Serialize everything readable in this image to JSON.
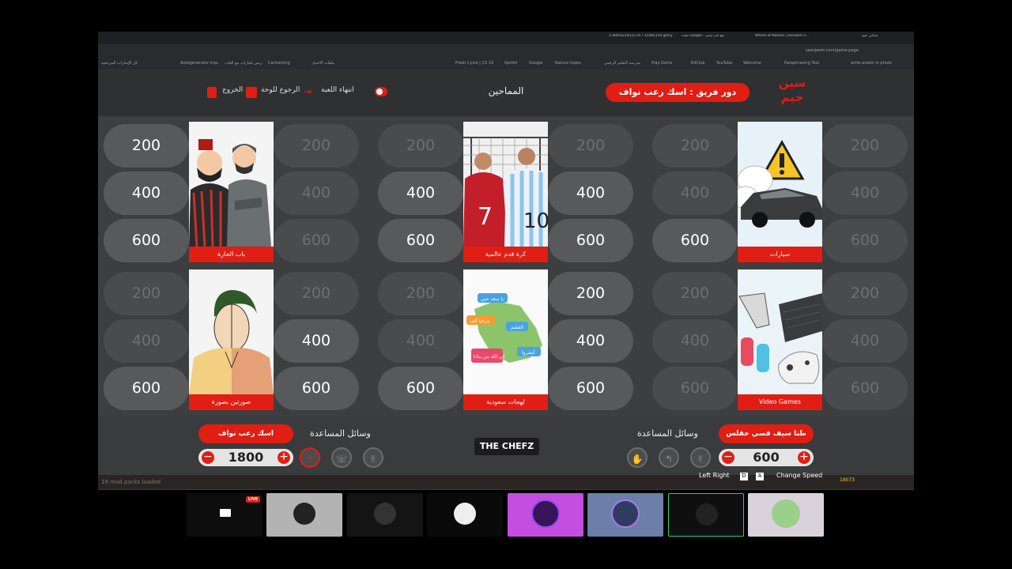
{
  "browser": {
    "tabs": [
      "17805021815176 / 31485150 gerry",
      "بحث Google - مع حب ليدي",
      "Wheel of Names | Random n...",
      "ساعي جيم"
    ],
    "url": "seenjeem.com/game-page",
    "bookmarks": [
      "كل الإشارات المرجعية",
      "Autogenerator input",
      "تدريس اشارات مع ألعاب",
      "Cartooning",
      "ملفات الاختبار",
      "Fresh Cycle | CS 101",
      "lipsfell",
      "Google",
      "Natura trajes",
      "مدرسة التعليم الرقمي",
      "Play Game",
      "EdClub",
      "YouTube",
      "Welcome",
      "Paraphrasing Tool",
      "write arabic in photo"
    ]
  },
  "header": {
    "team_turn_label": "دور فريق : اسك رعب نواف",
    "title": "المماحين",
    "end_game": "انتهاء اللعبة",
    "back_to_board": "الرجوع للوحة",
    "exit": "الخروج",
    "logo": "سين جيم",
    "brand_color": "#e01e14"
  },
  "board": {
    "categories": [
      {
        "name": "باب الحارة",
        "left": [
          {
            "v": "200",
            "used": false
          },
          {
            "v": "400",
            "used": false
          },
          {
            "v": "600",
            "used": false
          }
        ],
        "right": [
          {
            "v": "200",
            "used": true
          },
          {
            "v": "400",
            "used": true
          },
          {
            "v": "600",
            "used": true
          }
        ]
      },
      {
        "name": "كرة قدم عالمية",
        "left": [
          {
            "v": "200",
            "used": true
          },
          {
            "v": "400",
            "used": false
          },
          {
            "v": "600",
            "used": false
          }
        ],
        "right": [
          {
            "v": "200",
            "used": true
          },
          {
            "v": "400",
            "used": false
          },
          {
            "v": "600",
            "used": false
          }
        ]
      },
      {
        "name": "سيارات",
        "left": [
          {
            "v": "200",
            "used": true
          },
          {
            "v": "400",
            "used": true
          },
          {
            "v": "600",
            "used": false
          }
        ],
        "right": [
          {
            "v": "200",
            "used": true
          },
          {
            "v": "400",
            "used": true
          },
          {
            "v": "600",
            "used": true
          }
        ]
      },
      {
        "name": "صورتين بصورة",
        "left": [
          {
            "v": "200",
            "used": true
          },
          {
            "v": "400",
            "used": true
          },
          {
            "v": "600",
            "used": false
          }
        ],
        "right": [
          {
            "v": "200",
            "used": true
          },
          {
            "v": "400",
            "used": false
          },
          {
            "v": "600",
            "used": false
          }
        ]
      },
      {
        "name": "لهجات سعودية",
        "left": [
          {
            "v": "200",
            "used": true
          },
          {
            "v": "400",
            "used": true
          },
          {
            "v": "600",
            "used": false
          }
        ],
        "right": [
          {
            "v": "200",
            "used": false
          },
          {
            "v": "400",
            "used": false
          },
          {
            "v": "600",
            "used": false
          }
        ]
      },
      {
        "name": "Video Games",
        "left": [
          {
            "v": "200",
            "used": true
          },
          {
            "v": "400",
            "used": true
          },
          {
            "v": "600",
            "used": true
          }
        ],
        "right": [
          {
            "v": "200",
            "used": true
          },
          {
            "v": "400",
            "used": true
          },
          {
            "v": "600",
            "used": true
          }
        ]
      }
    ],
    "map_bubbles": [
      "يا سعد حيي",
      "مرحبا ألف",
      "القشم",
      "أبشروا",
      "كي الله من يدانا"
    ]
  },
  "footer": {
    "left_team": {
      "name": "اسك رعب نواف",
      "score": "1800",
      "help_title": "وسائل المساعدة"
    },
    "right_team": {
      "name": "طنا سيف قصي حقلس",
      "score": "600",
      "help_title": "وسائل المساعدة"
    },
    "sponsor": "THE CHEFZ",
    "overlay_text": [
      "19 mod packs loaded",
      "Left Right",
      "D",
      "A",
      "Change Speed",
      "18073"
    ]
  },
  "participants": {
    "live_badge": "LIVE",
    "count": 8
  }
}
